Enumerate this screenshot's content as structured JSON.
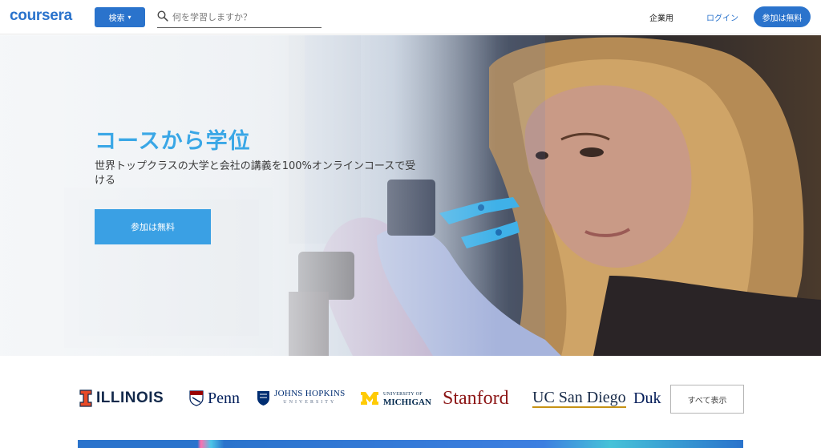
{
  "header": {
    "logo": "coursera",
    "explore_label": "検索",
    "search_placeholder": "何を学習しますか？",
    "enterprise_label": "企業用",
    "login_label": "ログイン",
    "join_label": "参加は無料"
  },
  "hero": {
    "title": "コースから学位",
    "subtitle": "世界トップクラスの大学と会社の講義を100%オンラインコースで受ける",
    "cta_label": "参加は無料"
  },
  "partners": {
    "items": [
      {
        "name": "ILLINOIS"
      },
      {
        "name": "Penn"
      },
      {
        "name": "JOHNS HOPKINS",
        "sub": "UNIVERSITY"
      },
      {
        "name": "MICHIGAN",
        "sub": "UNIVERSITY OF"
      },
      {
        "name": "Stanford"
      },
      {
        "name": "UC San Diego"
      },
      {
        "name": "Duk"
      }
    ],
    "see_all_label": "すべて表示"
  },
  "colors": {
    "brand_blue": "#2a73cc",
    "hero_title": "#3aa7e6",
    "cta_blue": "#3aa0e4"
  },
  "icons": {
    "search": "search-icon",
    "chevron": "chevron-down-icon"
  }
}
